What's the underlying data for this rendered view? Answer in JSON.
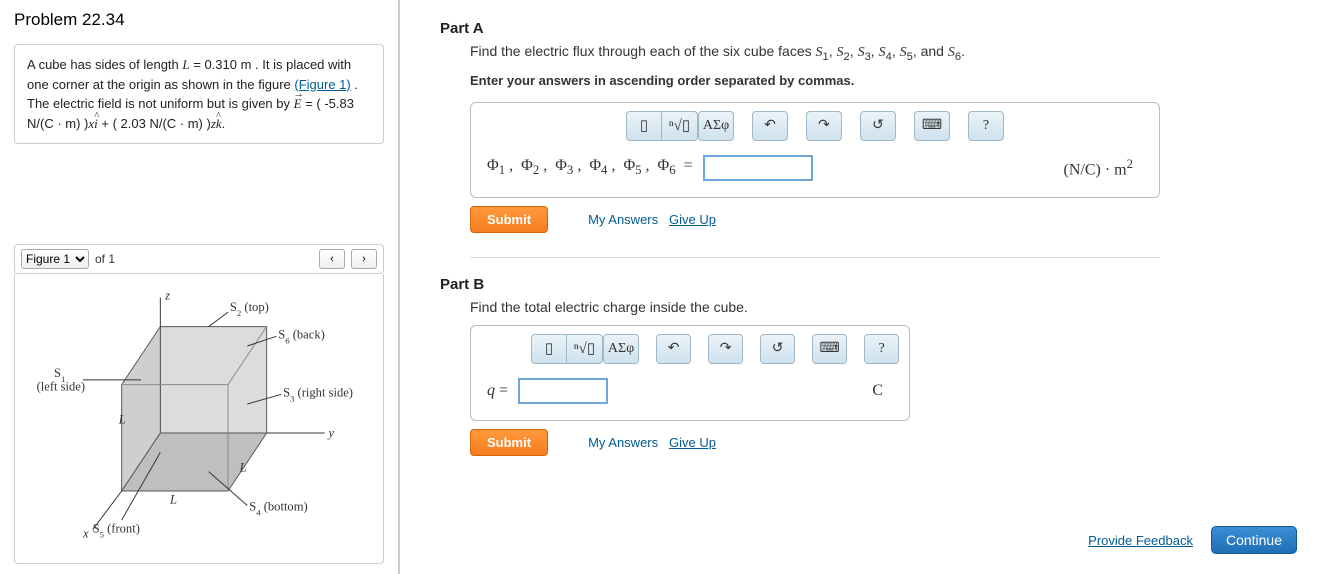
{
  "problem": {
    "title": "Problem 22.34",
    "text_parts": {
      "p1_a": "A cube has sides of length ",
      "p1_L": "L",
      "p1_eq": " = 0.310 ",
      "p1_unit": "m",
      "p1_b": " . It is placed with one corner at the origin as shown in the figure ",
      "fig_link": "(Figure 1)",
      "p1_c": " . The electric field is not uniform but is given by ",
      "E_vec": "E",
      "eq2": " = ( -5.83 ",
      "unit2a": "N/(C · m) )",
      "xi": "x",
      "ihat": "i",
      "plus": " + ( 2.03 ",
      "unit2b": "N/(C · m) )",
      "zk_z": "z",
      "khat": "k",
      "end": "."
    }
  },
  "figure": {
    "selector_label": "Figure 1",
    "of_text": "of 1",
    "labels": {
      "z": "z",
      "y": "y",
      "x": "x",
      "L": "L",
      "s1": "S₁",
      "s1_sub": "(left side)",
      "s2": "S₂ (top)",
      "s3": "S₃ (right side)",
      "s4": "S₄ (bottom)",
      "s5": "S₅ (front)",
      "s6": "S₆ (back)"
    }
  },
  "partA": {
    "heading": "Part A",
    "question": "Find the electric flux through each of the six cube faces S₁, S₂, S₃, S₄, S₅, and S₆.",
    "instruction": "Enter your answers in ascending order separated by commas.",
    "var_label": "Φ₁ ,  Φ₂ ,  Φ₃ ,  Φ₄ ,  Φ₅ ,  Φ₆  =",
    "unit": "(N/C) · m²",
    "submit": "Submit",
    "my_answers": "My Answers",
    "give_up": "Give Up"
  },
  "partB": {
    "heading": "Part B",
    "question": "Find the total electric charge inside the cube.",
    "var_label": "q =",
    "unit": "C",
    "submit": "Submit",
    "my_answers": "My Answers",
    "give_up": "Give Up"
  },
  "toolbar": {
    "template": "▯",
    "sqrt": "ⁿ√▯",
    "greek": "ΑΣφ",
    "undo": "↶",
    "redo": "↷",
    "reset": "↺",
    "keyboard": "⌨",
    "help": "?"
  },
  "footer": {
    "feedback": "Provide Feedback",
    "continue": "Continue"
  }
}
